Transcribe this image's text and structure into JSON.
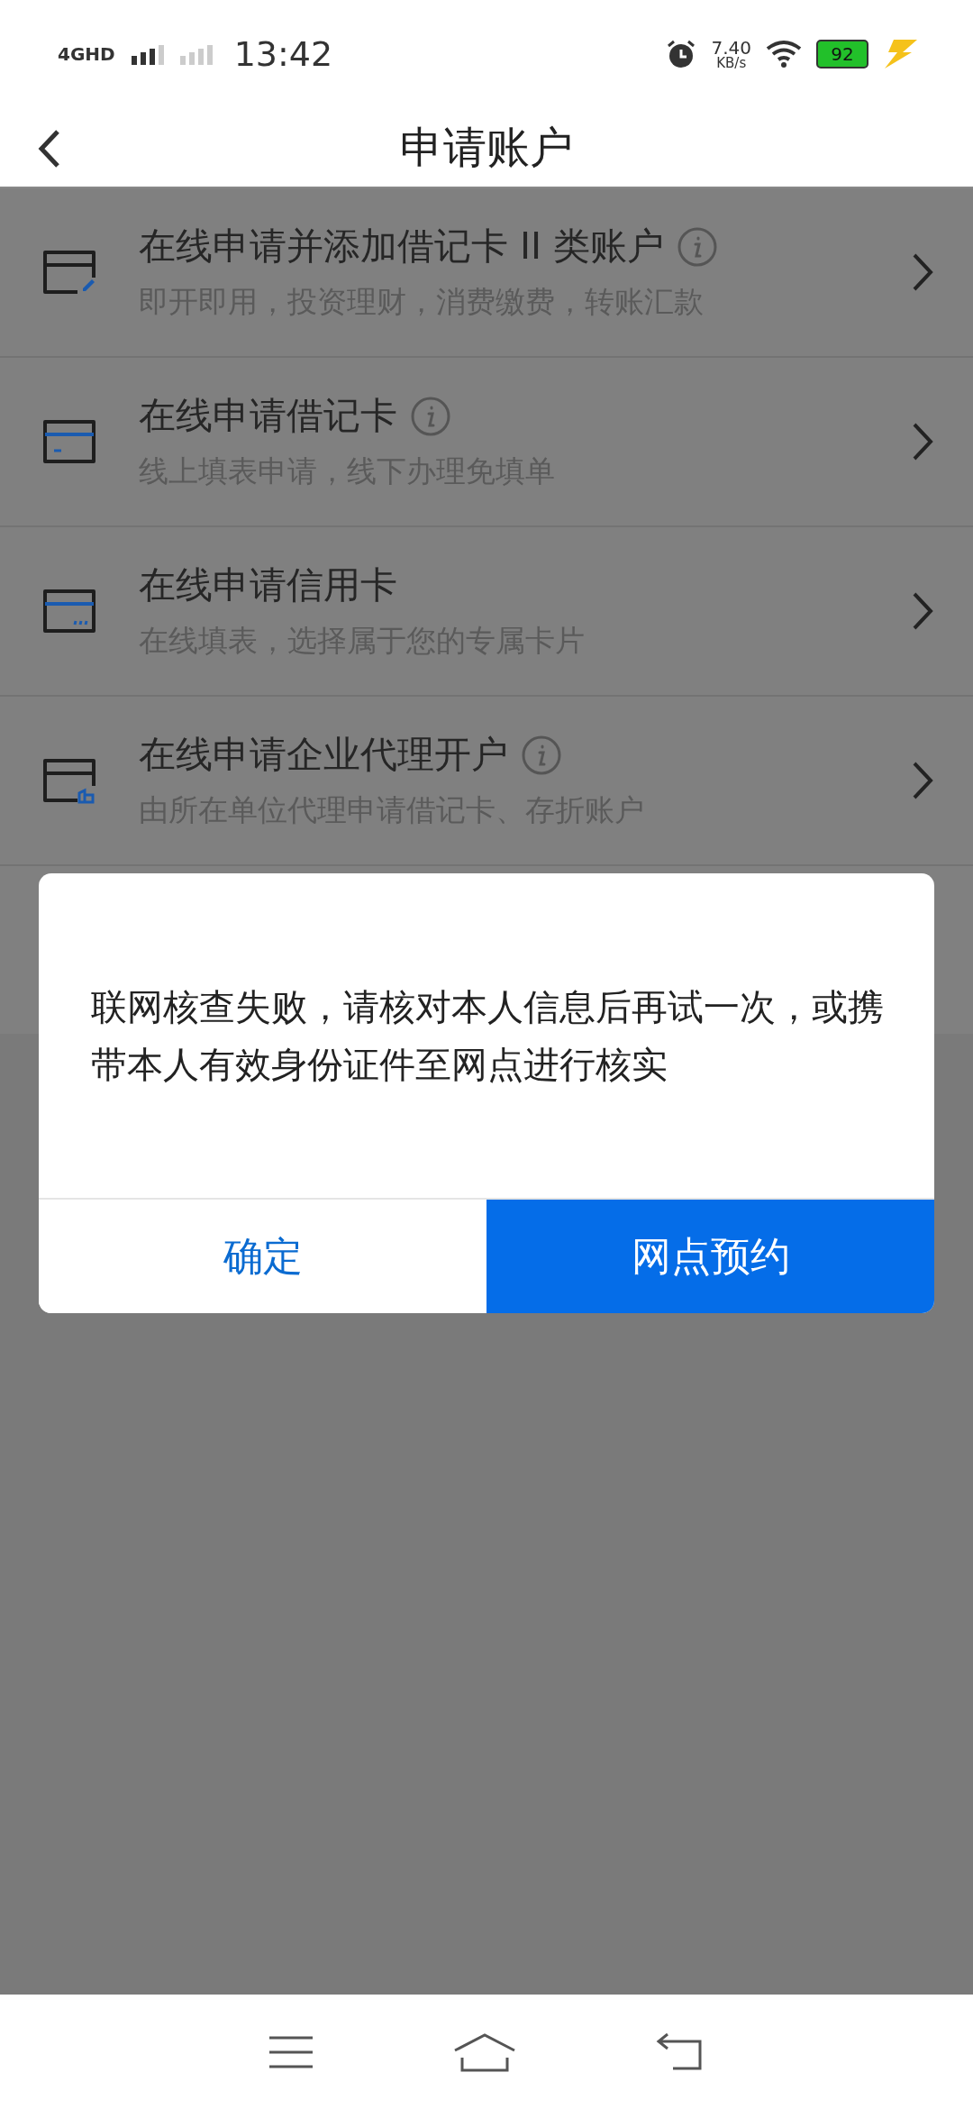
{
  "status_bar": {
    "network": "4GHD",
    "time": "13:42",
    "speed_value": "7.40",
    "speed_unit": "KB/s",
    "battery": "92"
  },
  "header": {
    "title": "申请账户"
  },
  "items": [
    {
      "title": "在线申请并添加借记卡 II 类账户",
      "subtitle": "即开即用，投资理财，消费缴费，转账汇款",
      "info": true
    },
    {
      "title": "在线申请借记卡",
      "subtitle": "线上填表申请，线下办理免填单",
      "info": true
    },
    {
      "title": "在线申请信用卡",
      "subtitle": "在线填表，选择属于您的专属卡片",
      "info": false
    },
    {
      "title": "在线申请企业代理开户",
      "subtitle": "由所在单位代理申请借记卡、存折账户",
      "info": true
    }
  ],
  "dialog": {
    "message": "联网核查失败，请核对本人信息后再试一次，或携带本人有效身份证件至网点进行核实",
    "buttons": [
      {
        "label": "确定",
        "kind": "secondary"
      },
      {
        "label": "网点预约",
        "kind": "primary"
      }
    ]
  }
}
